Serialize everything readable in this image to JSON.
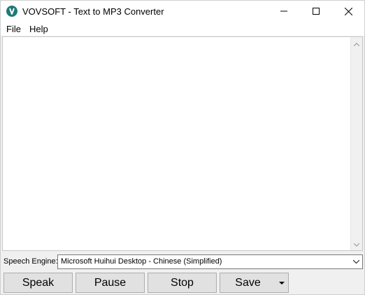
{
  "window": {
    "title": "VOVSOFT - Text to MP3 Converter",
    "app_icon": "vovsoft-logo-icon",
    "controls": [
      "minimize-icon",
      "maximize-icon",
      "close-icon"
    ]
  },
  "menu": {
    "items": [
      {
        "label": "File"
      },
      {
        "label": "Help"
      }
    ]
  },
  "editor": {
    "text": ""
  },
  "engine": {
    "label": "Speech Engine:",
    "selected": "Microsoft Huihui Desktop - Chinese (Simplified)"
  },
  "buttons": {
    "speak": "Speak",
    "pause": "Pause",
    "stop": "Stop",
    "save": "Save"
  },
  "colors": {
    "app_icon": "#1f7a7a",
    "button_face": "#e1e1e1",
    "window_bg": "#f0f0f0"
  }
}
